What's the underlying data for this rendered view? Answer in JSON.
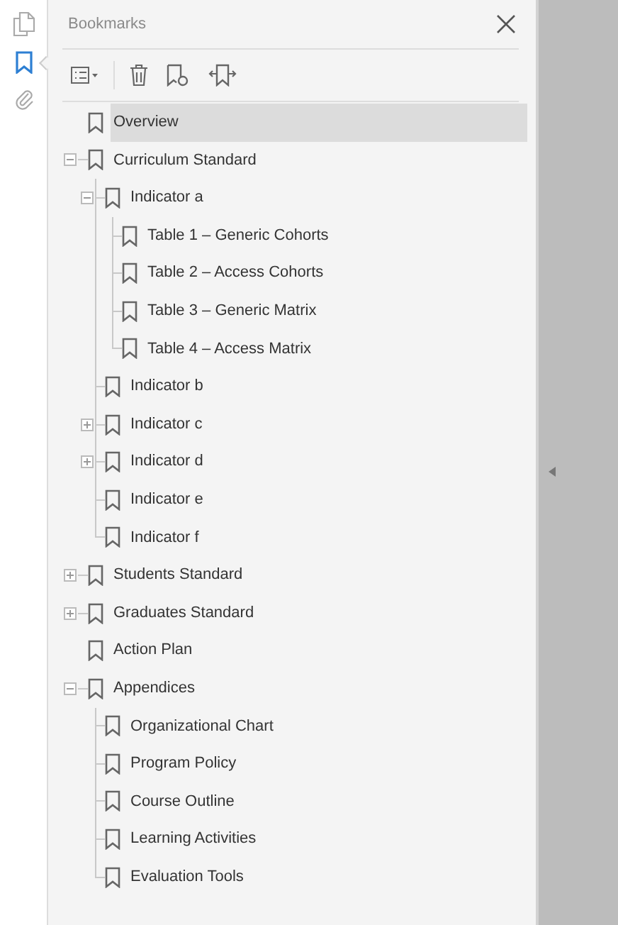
{
  "side_rail": [
    {
      "kind": "pages",
      "selected": false
    },
    {
      "kind": "bookmarks",
      "selected": true
    },
    {
      "kind": "attachments",
      "selected": false
    }
  ],
  "panel": {
    "title": "Bookmarks"
  },
  "bookmarks": [
    {
      "label": "Overview",
      "selected": true
    },
    {
      "label": "Curriculum Standard",
      "selected": false,
      "expanded": true,
      "children": [
        {
          "label": "Indicator a",
          "selected": false,
          "expanded": true,
          "children": [
            {
              "label": "Table 1 – Generic Cohorts",
              "selected": false
            },
            {
              "label": "Table 2 – Access Cohorts",
              "selected": false
            },
            {
              "label": "Table 3 – Generic Matrix",
              "selected": false
            },
            {
              "label": "Table 4 – Access Matrix",
              "selected": false
            }
          ]
        },
        {
          "label": "Indicator b",
          "selected": false
        },
        {
          "label": "Indicator c",
          "selected": false,
          "expanded": false
        },
        {
          "label": "Indicator d",
          "selected": false,
          "expanded": false
        },
        {
          "label": "Indicator e",
          "selected": false
        },
        {
          "label": "Indicator f",
          "selected": false
        }
      ]
    },
    {
      "label": "Students Standard",
      "selected": false,
      "expanded": false
    },
    {
      "label": "Graduates Standard",
      "selected": false,
      "expanded": false
    },
    {
      "label": "Action Plan",
      "selected": false
    },
    {
      "label": "Appendices",
      "selected": false,
      "expanded": true,
      "children": [
        {
          "label": "Organizational Chart",
          "selected": false
        },
        {
          "label": "Program Policy",
          "selected": false
        },
        {
          "label": "Course Outline",
          "selected": false
        },
        {
          "label": "Learning Activities",
          "selected": false
        },
        {
          "label": "Evaluation Tools",
          "selected": false
        }
      ]
    }
  ]
}
